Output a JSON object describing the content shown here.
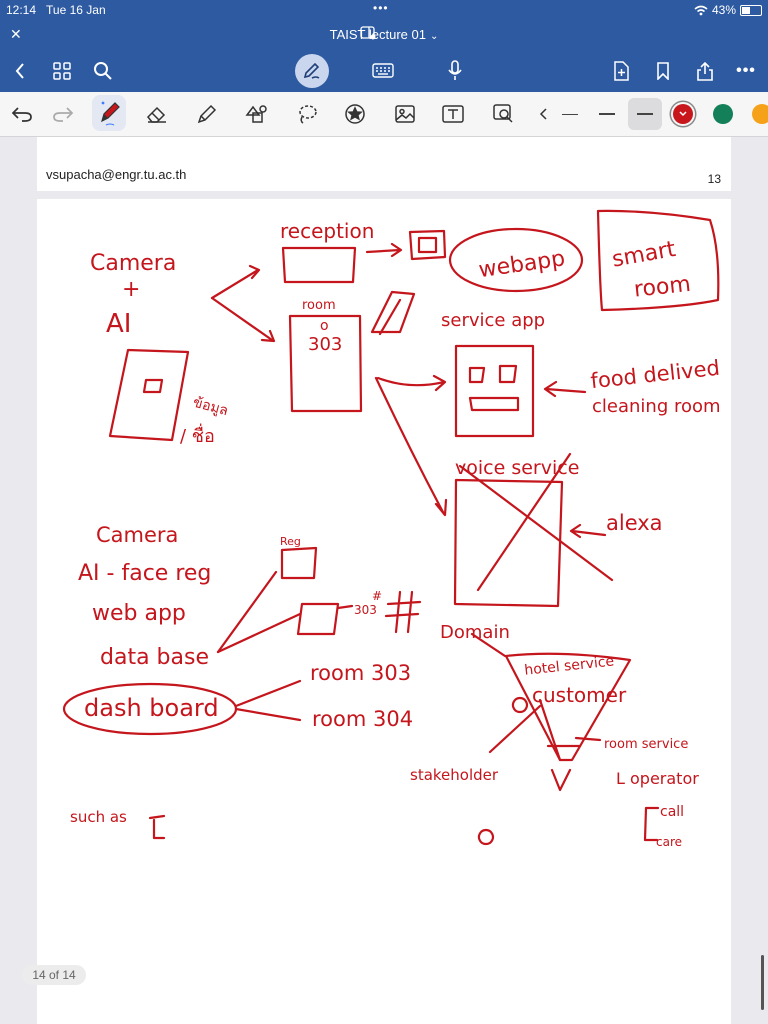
{
  "status_bar": {
    "time": "12:14",
    "date": "Tue 16 Jan",
    "battery": "43%",
    "battery_level": 0.43
  },
  "document": {
    "title": "TAIST lecture 01",
    "email": "vsupacha@engr.tu.ac.th",
    "page_number": "13",
    "page_indicator": "14 of 14"
  },
  "toolbar": {
    "colors": [
      "#c8171c",
      "#138059",
      "#f6a11a"
    ],
    "selected_color": "#c8171c"
  },
  "handwriting": {
    "reception": "reception",
    "webapp": "webapp",
    "smart": "smart",
    "room": "room",
    "camera_top": "Camera",
    "plus": "+",
    "ai": "AI",
    "room_label": "room",
    "room_number": "303",
    "service_app": "service app",
    "food_delivery": "food delived",
    "cleaning_room": "cleaning room",
    "thai_1": "ข้อมูล",
    "thai_2": "/ ชื่อ",
    "voice_service": "voice service",
    "alexa": "alexa",
    "camera_list": "Camera",
    "ai_face_reg": "AI - face reg",
    "web_app": "web app",
    "data_base": "data base",
    "dashboard": "dash board",
    "room_303": "room 303",
    "room_304": "room 304",
    "reg": "Reg",
    "num_303": "303",
    "domain": "Domain",
    "hotel_service": "hotel service",
    "customer": "customer",
    "room_service": "room service",
    "stakeholder": "stakeholder",
    "operator": "L operator",
    "call": "call",
    "care": "care",
    "such_as": "such as",
    "hash": "#"
  }
}
